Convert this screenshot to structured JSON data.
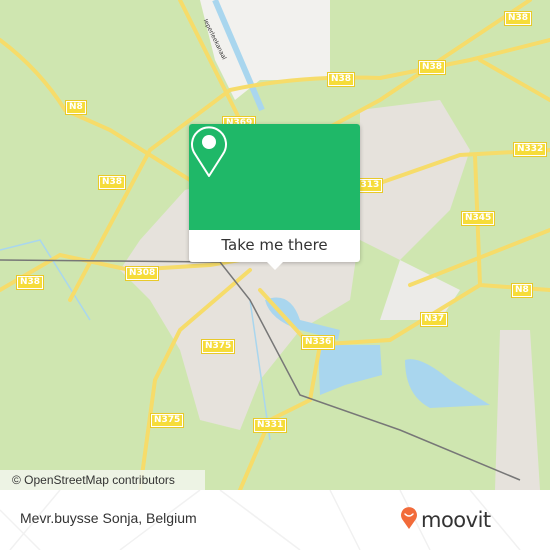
{
  "map": {
    "road_labels": [
      {
        "id": "n8-nw",
        "text": "N8"
      },
      {
        "id": "n38-w1",
        "text": "N38"
      },
      {
        "id": "n38-w2",
        "text": "N38"
      },
      {
        "id": "n38-n1",
        "text": "N38"
      },
      {
        "id": "n38-n2",
        "text": "N38"
      },
      {
        "id": "n38-ne",
        "text": "N38"
      },
      {
        "id": "n369",
        "text": "N369"
      },
      {
        "id": "n313",
        "text": "N313"
      },
      {
        "id": "n332",
        "text": "N332"
      },
      {
        "id": "n345",
        "text": "N345"
      },
      {
        "id": "n8-e",
        "text": "N8"
      },
      {
        "id": "n37",
        "text": "N37"
      },
      {
        "id": "n308",
        "text": "N308"
      },
      {
        "id": "n375-1",
        "text": "N375"
      },
      {
        "id": "n375-2",
        "text": "N375"
      },
      {
        "id": "n336",
        "text": "N336"
      },
      {
        "id": "n331",
        "text": "N331"
      }
    ],
    "canal_label": "Ieperleekanaal",
    "attribution": "© OpenStreetMap contributors",
    "colors": {
      "land": "#cfe6b0",
      "urban": "#e8e4e0",
      "water": "#a9d6ee",
      "road": "#f6dc6a",
      "rail": "#777777"
    }
  },
  "popup": {
    "icon": "location-pin-icon",
    "button_label": "Take me there",
    "color": "#1fb868"
  },
  "footer": {
    "place_title": "Mevr.buysse Sonja, Belgium",
    "brand": "moovit",
    "brand_color": "#f26b3a"
  }
}
